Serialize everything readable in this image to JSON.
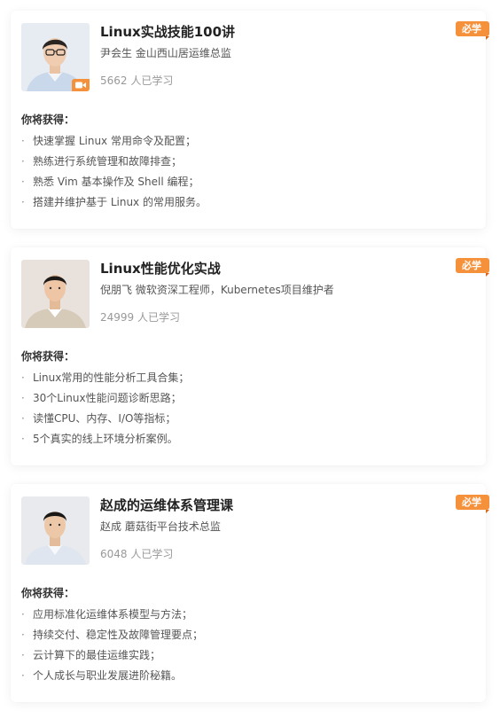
{
  "gain_heading": "你将获得：",
  "required_tag": "必学",
  "colors": {
    "tag": "#f5913b",
    "tag_fold": "#d9681a",
    "title": "#222222",
    "muted": "#999999"
  },
  "courses": [
    {
      "title": "Linux实战技能100讲",
      "author": "尹会生 金山西山居运维总监",
      "learners": "5662 人已学习",
      "has_video_badge": true,
      "bullets": [
        "快速掌握 Linux 常用命令及配置；",
        "熟练进行系统管理和故障排查；",
        "熟悉 Vim 基本操作及 Shell 编程；",
        "搭建并维护基于 Linux 的常用服务。"
      ]
    },
    {
      "title": "Linux性能优化实战",
      "author": "倪朋飞 微软资深工程师，Kubernetes项目维护者",
      "learners": "24999 人已学习",
      "has_video_badge": false,
      "bullets": [
        "Linux常用的性能分析工具合集；",
        "30个Linux性能问题诊断思路；",
        "读懂CPU、内存、I/O等指标；",
        "5个真实的线上环境分析案例。"
      ]
    },
    {
      "title": "赵成的运维体系管理课",
      "author": "赵成 蘑菇街平台技术总监",
      "learners": "6048 人已学习",
      "has_video_badge": false,
      "bullets": [
        "应用标准化运维体系模型与方法；",
        "持续交付、稳定性及故障管理要点；",
        "云计算下的最佳运维实践；",
        "个人成长与职业发展进阶秘籍。"
      ]
    }
  ]
}
